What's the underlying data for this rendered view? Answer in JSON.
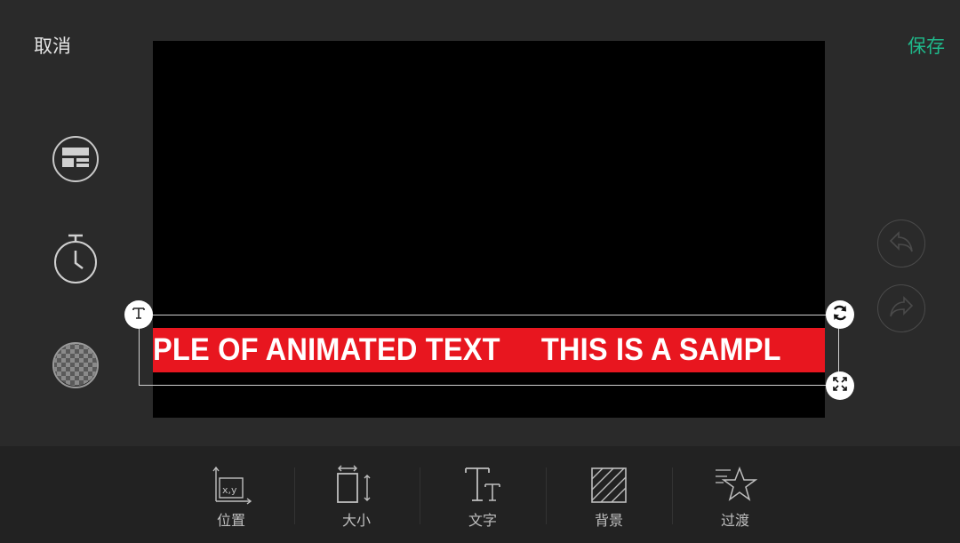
{
  "topbar": {
    "cancel_label": "取消",
    "save_label": "保存"
  },
  "left_tools": [
    {
      "icon": "layout-icon"
    },
    {
      "icon": "timer-icon"
    },
    {
      "icon": "transparency-icon"
    }
  ],
  "right_tools": [
    {
      "icon": "undo-icon"
    },
    {
      "icon": "redo-icon"
    }
  ],
  "text_overlay": {
    "ticker_text": "PLE OF ANIMATED TEXT     THIS IS A SAMPL",
    "ticker_background": "#e8161f",
    "ticker_text_color": "#ffffff"
  },
  "bottom_tabs": [
    {
      "label": "位置",
      "icon": "position-icon",
      "icon_text": "x,y"
    },
    {
      "label": "大小",
      "icon": "size-icon"
    },
    {
      "label": "文字",
      "icon": "text-style-icon"
    },
    {
      "label": "背景",
      "icon": "background-icon"
    },
    {
      "label": "过渡",
      "icon": "transition-icon"
    }
  ],
  "colors": {
    "accent": "#1fb88a",
    "background": "#2a2a2a",
    "toolbar": "#222222"
  }
}
